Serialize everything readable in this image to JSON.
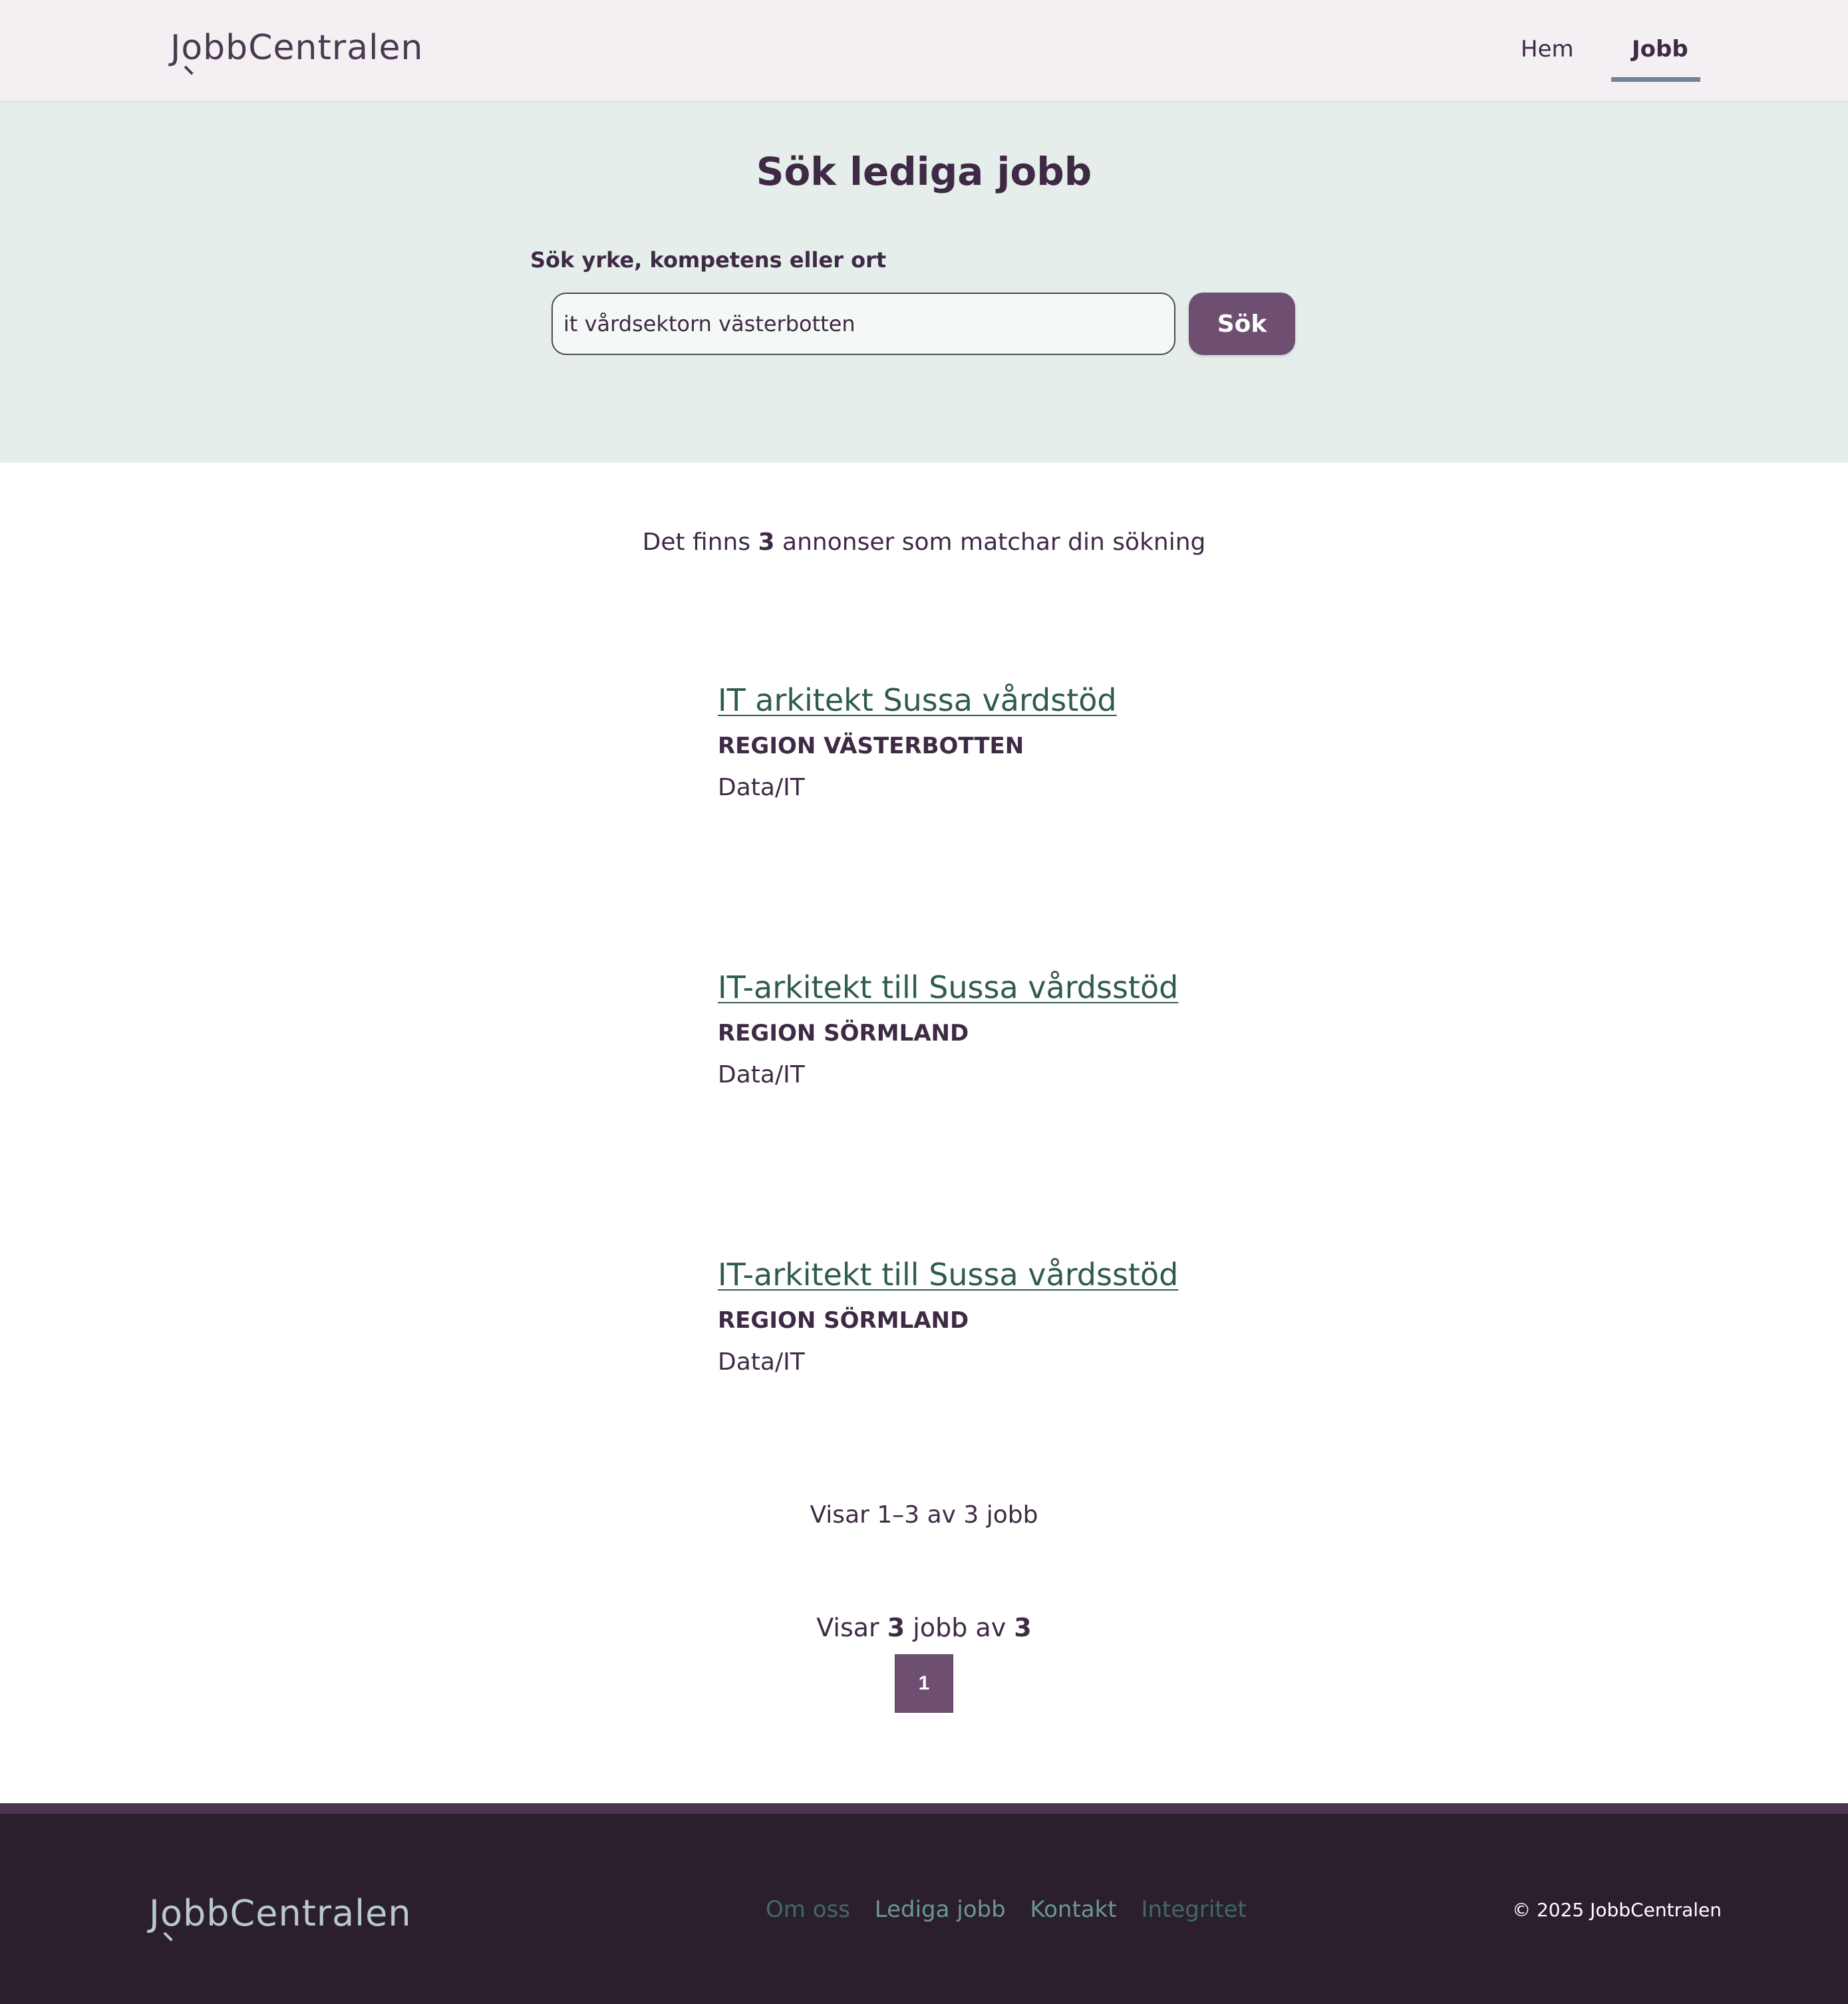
{
  "brand": {
    "name_prefix": "J",
    "name_o": "o",
    "name_suffix": "bbCentralen"
  },
  "nav": {
    "home": "Hem",
    "jobs": "Jobb",
    "active": "Jobb"
  },
  "hero": {
    "title": "Sök lediga jobb",
    "search_label": "Sök yrke, kompetens eller ort",
    "search_value": "it vårdsektorn västerbotten",
    "search_button": "Sök"
  },
  "results": {
    "count_prefix": "Det finns ",
    "count": "3",
    "count_suffix": " annonser som matchar din sökning"
  },
  "jobs": [
    {
      "title": "IT arkitekt Sussa vårdstöd",
      "employer": "REGION VÄSTERBOTTEN",
      "category": "Data/IT"
    },
    {
      "title": "IT-arkitekt till Sussa vårdsstöd",
      "employer": "REGION SÖRMLAND",
      "category": "Data/IT"
    },
    {
      "title": "IT-arkitekt till Sussa vårdsstöd",
      "employer": "REGION SÖRMLAND",
      "category": "Data/IT"
    }
  ],
  "pagination": {
    "showing_text": "Visar 1–3 av 3 jobb",
    "showing_prefix": "Visar ",
    "shown": "3",
    "showing_middle": " jobb av ",
    "total": "3",
    "current_page": "1"
  },
  "footer": {
    "links": [
      "Om oss",
      "Lediga jobb",
      "Kontakt",
      "Integritet"
    ],
    "copyright": "© 2025 JobbCentralen"
  },
  "colors": {
    "accent": "#6e4f72",
    "link": "#2f5a50",
    "hero_bg": "#e6eeeb",
    "header_bg": "#f4eff3",
    "footer_bg": "#2b1f2d"
  }
}
